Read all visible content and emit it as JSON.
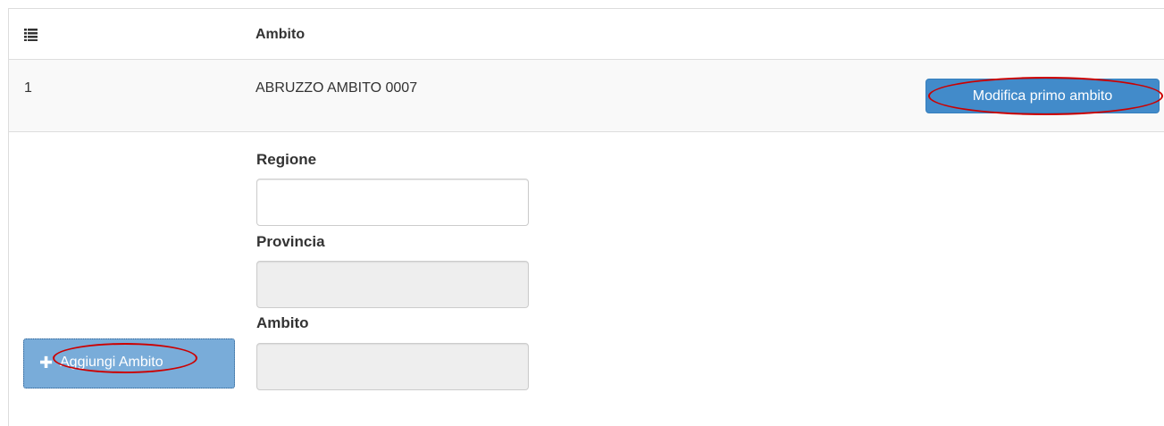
{
  "table": {
    "header": {
      "index_icon": "list-icon",
      "ambito_label": "Ambito"
    },
    "rows": [
      {
        "number": "1",
        "ambito": "ABRUZZO AMBITO 0007",
        "button_label": "Modifica primo ambito"
      }
    ]
  },
  "form": {
    "regione_label": "Regione",
    "regione_value": "",
    "provincia_label": "Provincia",
    "provincia_value": "",
    "ambito_label": "Ambito",
    "ambito_value": "",
    "add_button_icon": "plus-icon",
    "add_button_label": "Aggiungi Ambito"
  },
  "colors": {
    "primary_button": "#428bca",
    "disabled_button": "#79acd9",
    "highlight_ellipse": "#cc0000",
    "row_stripe": "#f9f9f9",
    "disabled_input": "#eeeeee"
  }
}
